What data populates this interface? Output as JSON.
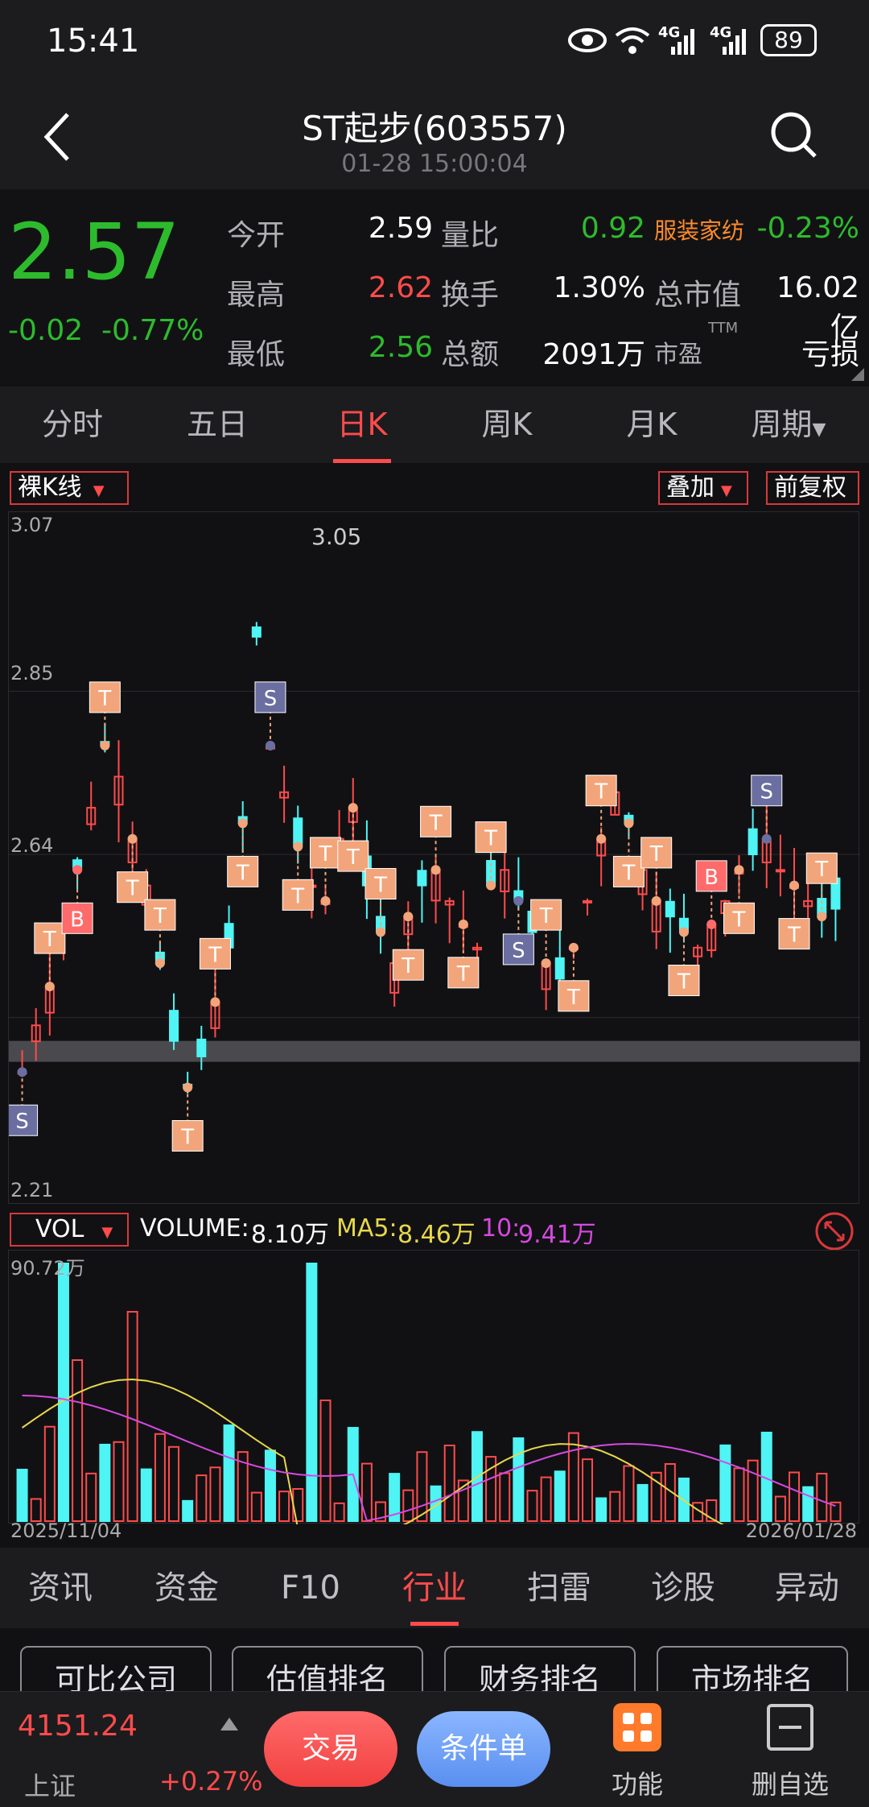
{
  "status": {
    "time": "15:41",
    "battery": "89",
    "net1": "4G",
    "net2": "4G"
  },
  "header": {
    "title": "ST起步(603557)",
    "subtitle": "01-28 15:00:04"
  },
  "quote": {
    "price": "2.57",
    "change": "-0.02",
    "change_pct": "-0.77%",
    "open_label": "今开",
    "open": "2.59",
    "high_label": "最高",
    "high": "2.62",
    "low_label": "最低",
    "low": "2.56",
    "vr_label": "量比",
    "vr": "0.92",
    "turnover_label": "换手",
    "turnover": "1.30%",
    "amount_label": "总额",
    "amount": "2091万",
    "industry": "服装家纺",
    "industry_pct": "-0.23%",
    "mktcap_label": "总市值",
    "mktcap": "16.02亿",
    "pe_label": "市盈",
    "pe_sup": "TTM",
    "pe": "亏损"
  },
  "tabs": [
    "分时",
    "五日",
    "日K",
    "周K",
    "月K",
    "周期"
  ],
  "active_tab": "日K",
  "kline_tools": {
    "left": "裸K线",
    "overlay": "叠加",
    "adjust": "前复权"
  },
  "chart_data": {
    "type": "candlestick",
    "y_labels": [
      "3.07",
      "2.85",
      "2.64",
      "2.21"
    ],
    "ylim": [
      2.21,
      3.07
    ],
    "max_label": "3.05",
    "markers": [
      "T",
      "S",
      "B"
    ],
    "start_date": "2025/11/04",
    "end_date": "2026/01/28",
    "up_color": "#ff4b4b",
    "down_color": "#4ff4f4"
  },
  "vol": {
    "selector": "VOL",
    "volume_label": "VOLUME:",
    "volume": "8.10万",
    "ma5_label": "MA5:",
    "ma5": "8.46万",
    "ma10_label": "10:",
    "ma10": "9.41万",
    "max": "90.72万"
  },
  "bottom_tabs": [
    "资讯",
    "资金",
    "F10",
    "行业",
    "扫雷",
    "诊股",
    "异动"
  ],
  "active_bottom_tab": "行业",
  "sub_buttons": [
    "可比公司",
    "估值排名",
    "财务排名",
    "市场排名"
  ],
  "bottom": {
    "index_value": "4151.24",
    "index_name": "上证",
    "index_pct": "+0.27%",
    "trade": "交易",
    "condition": "条件单",
    "function": "功能",
    "remove": "删自选"
  }
}
